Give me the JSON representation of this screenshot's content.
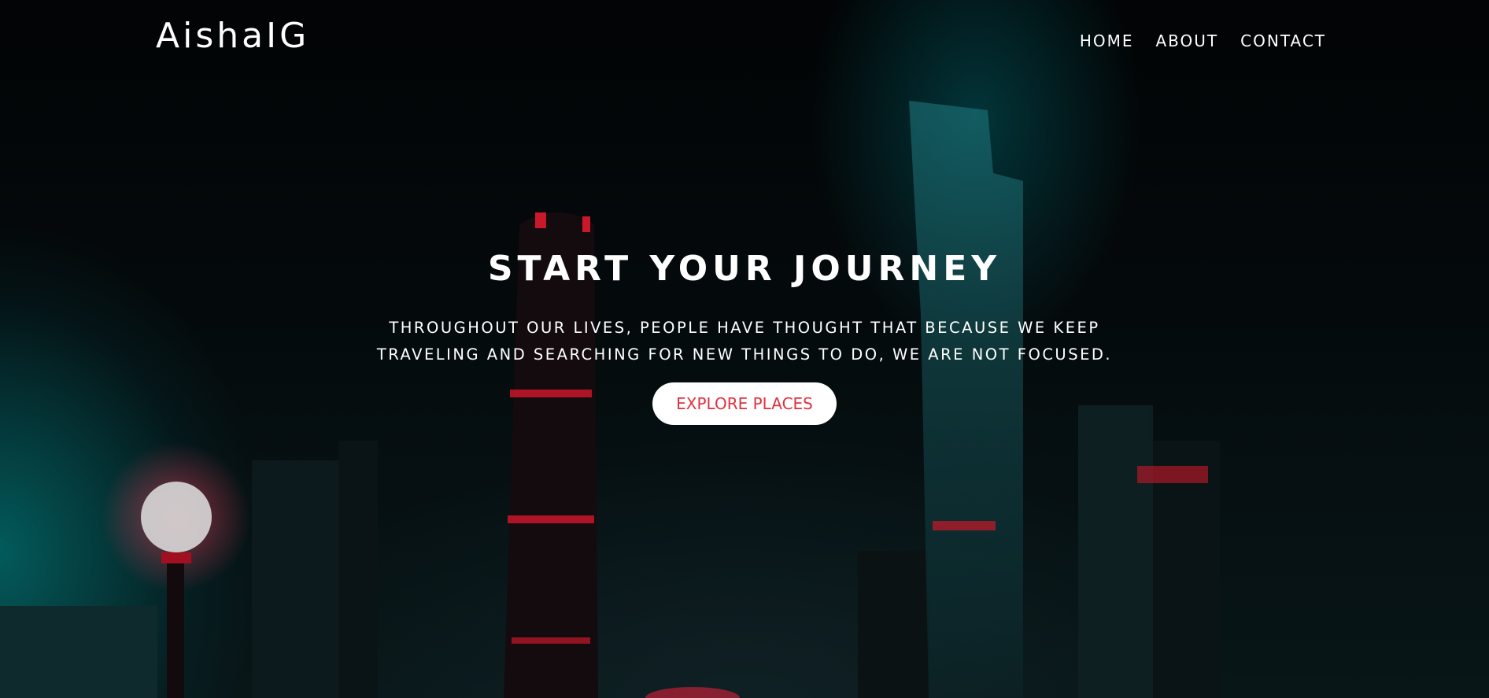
{
  "brand": {
    "name": "AishaIG"
  },
  "nav": {
    "items": [
      {
        "label": "HOME"
      },
      {
        "label": "ABOUT"
      },
      {
        "label": "CONTACT"
      }
    ]
  },
  "hero": {
    "title": "START YOUR JOURNEY",
    "text": "THROUGHOUT OUR LIVES, PEOPLE HAVE THOUGHT THAT BECAUSE WE KEEP TRAVELING AND SEARCHING FOR NEW THINGS TO DO, WE ARE NOT FOCUSED.",
    "cta_label": "EXPLORE PLACES"
  },
  "background": {
    "description_icon": "city-skyline-night",
    "accent_color": "#e0313f",
    "glow_color": "#0a8f94"
  }
}
